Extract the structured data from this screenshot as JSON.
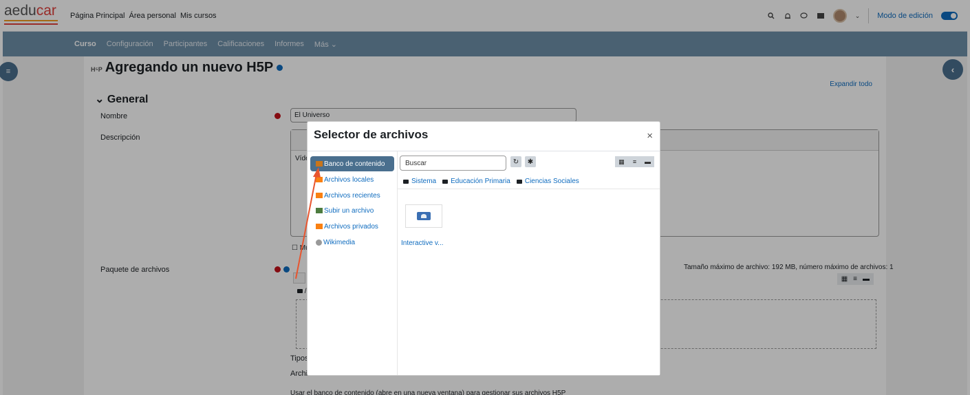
{
  "brand": {
    "logo_a": "aedu",
    "logo_b": "car"
  },
  "topnav": [
    "Página Principal",
    "Área personal",
    "Mis cursos"
  ],
  "topright": {
    "edit_mode": "Modo de edición"
  },
  "secnav": {
    "items": [
      "Curso",
      "Configuración",
      "Participantes",
      "Calificaciones",
      "Informes",
      "Más ⌄"
    ]
  },
  "page": {
    "small_icon": "H⁵P",
    "title": "Agregando un nuevo H5P",
    "expand_all": "Expandir todo",
    "general": "General",
    "name_label": "Nombre",
    "name_value": "El Universo",
    "desc_label": "Descripción",
    "desc_text": "Víde",
    "show_check": "Mu",
    "package_label": "Paquete de archivos",
    "file_max": "Tamaño máximo de archivo: 192 MB, número máximo de archivos: 1",
    "folder_letter": "/",
    "tipos": "Tipos",
    "archiv": "Archiv",
    "usar": "Usar el banco de contenido (abre en una nueva ventana) para gestionar sus archivos H5P"
  },
  "modal": {
    "title": "Selector de archivos",
    "close": "×",
    "repos": [
      {
        "label": "Banco de contenido",
        "icon": "content-bank-icon",
        "color": "#c9751b"
      },
      {
        "label": "Archivos locales",
        "icon": "moodle-icon",
        "color": "#f98012"
      },
      {
        "label": "Archivos recientes",
        "icon": "moodle-icon",
        "color": "#f98012"
      },
      {
        "label": "Subir un archivo",
        "icon": "upload-icon",
        "color": "#4d7c3f"
      },
      {
        "label": "Archivos privados",
        "icon": "moodle-icon",
        "color": "#f98012"
      },
      {
        "label": "Wikimedia",
        "icon": "wikimedia-icon",
        "color": "#999999"
      }
    ],
    "search_placeholder": "Buscar",
    "breadcrumb": [
      "Sistema",
      "Educación Primaria",
      "Ciencias Sociales"
    ],
    "file_label": "Interactive v..."
  },
  "colors": {
    "accent": "#0f6cbf",
    "secnav": "#6e8fa9",
    "active_repo": "#4a6f8e",
    "annotation_arrow": "#e8552f"
  }
}
